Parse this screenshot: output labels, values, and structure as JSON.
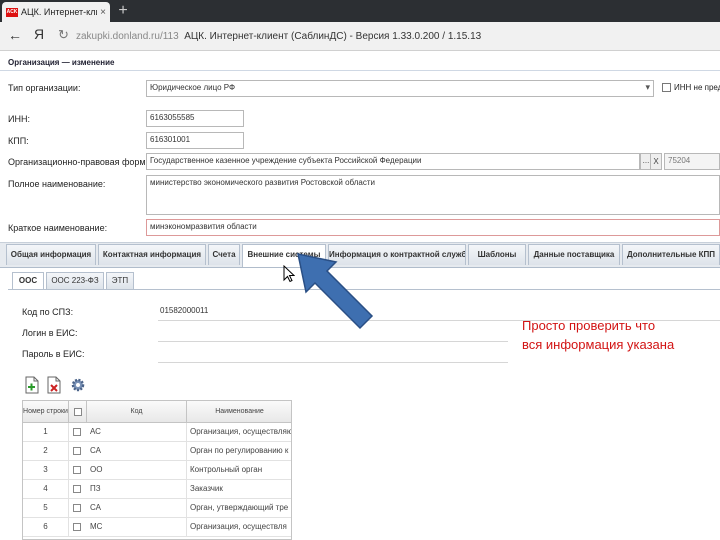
{
  "browser": {
    "tab_title": "АЦК. Интернет-клиент",
    "tab_close": "×",
    "new_tab": "+",
    "favicon_text": "ACK",
    "back": "←",
    "yandex": "Я",
    "refresh": "↻",
    "url_domain": "zakupki.donland.ru/113",
    "url_title": "АЦК. Интернет-клиент (СаблинДС) - Версия 1.33.0.200 / 1.15.13"
  },
  "panel": {
    "title": "Организация — изменение"
  },
  "form": {
    "type_label": "Тип организации:",
    "type_value": "Юридическое лицо РФ",
    "inn_not_provided_label": "ИНН не пред",
    "inn_label": "ИНН:",
    "inn_value": "6163055585",
    "kpp_label": "КПП:",
    "kpp_value": "616301001",
    "opf_label": "Организационно-правовая форма:",
    "opf_value": "Государственное казенное учреждение субъекта Российской Федерации",
    "opf_btn_dots": "...",
    "opf_btn_x": "X",
    "opf_code": "75204",
    "fullname_label": "Полное наименование:",
    "fullname_value": "министерство экономического развития Ростовской области",
    "shortname_label": "Краткое наименование:",
    "shortname_value": "минэкономразвития области"
  },
  "tabs": [
    "Общая информация",
    "Контактная информация",
    "Счета",
    "Внешние системы",
    "Информация о контрактной службе",
    "Шаблоны",
    "Данные поставщика",
    "Дополнительные КПП"
  ],
  "subtabs": [
    "ООС",
    "ООС 223-ФЗ",
    "ЭТП"
  ],
  "external": {
    "spz_label": "Код по СПЗ:",
    "spz_value": "01582000011",
    "login_label": "Логин в ЕИС:",
    "password_label": "Пароль в ЕИС:"
  },
  "grid": {
    "headers": [
      "Номер строки",
      "",
      "Код",
      "Наименование"
    ],
    "rows": [
      {
        "num": "1",
        "code": "АС",
        "name": "Организация, осуществляющ"
      },
      {
        "num": "2",
        "code": "СА",
        "name": "Орган по регулированию к"
      },
      {
        "num": "3",
        "code": "ОО",
        "name": "Контрольный орган"
      },
      {
        "num": "4",
        "code": "ПЗ",
        "name": "Заказчик"
      },
      {
        "num": "5",
        "code": "СА",
        "name": "Орган, утверждающий тре"
      },
      {
        "num": "6",
        "code": "МС",
        "name": "Организация, осуществля"
      }
    ]
  },
  "annotation": {
    "line1": "Просто проверить что",
    "line2": "вся информация указана",
    "arrow_color": "#3e6fb0"
  },
  "icons": [
    "add-row-icon",
    "delete-row-icon",
    "settings-gear-icon",
    "mouse-cursor-icon",
    "pointer-arrow-icon"
  ]
}
